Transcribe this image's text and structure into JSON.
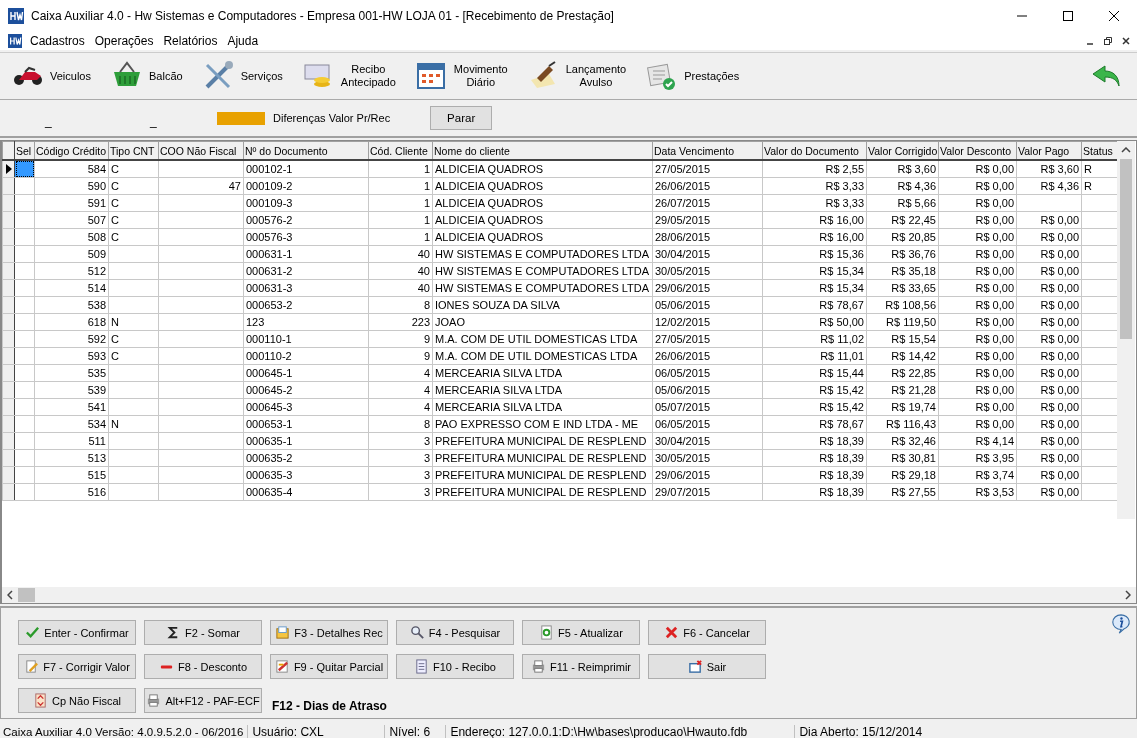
{
  "window": {
    "title": "Caixa Auxiliar 4.0 - Hw Sistemas e Computadores - Empresa 001-HW LOJA 01 - [Recebimento de Prestação]"
  },
  "menu": [
    "Cadastros",
    "Operações",
    "Relatórios",
    "Ajuda"
  ],
  "toolbar": [
    {
      "label": "Veiculos"
    },
    {
      "label": "Balcão"
    },
    {
      "label": "Serviços"
    },
    {
      "label": "Recibo\nAntecipado"
    },
    {
      "label": "Movimento\nDiário"
    },
    {
      "label": "Lançamento\nAvulso"
    },
    {
      "label": "Prestações"
    }
  ],
  "filter_bar": {
    "marks": [
      "_",
      "_"
    ],
    "legend": {
      "label": "Diferenças  Valor Pr/Rec",
      "color": "#e8a100"
    },
    "button": "Parar"
  },
  "table": {
    "columns": [
      "Sel",
      "Código Crédito",
      "Tipo CNT",
      "COO Não Fiscal",
      "Nº do Documento",
      "Cód. Cliente",
      "Nome do cliente",
      "Data Vencimento",
      "Valor do Documento",
      "Valor Corrigido",
      "Valor Desconto",
      "Valor Pago",
      "Status"
    ],
    "rows": [
      {
        "selected": true,
        "codigo": "584",
        "tipo": "C",
        "doc": "000102-1",
        "cliente": "1",
        "nome": "ALDICEIA QUADROS",
        "venc": "27/05/2015",
        "valor": "R$ 2,55",
        "corrigido": "R$ 3,60",
        "desconto": "R$ 0,00",
        "pago": "R$ 3,60",
        "status": "R"
      },
      {
        "selected": false,
        "codigo": "590",
        "tipo": "C",
        "coo": "47",
        "doc": "000109-2",
        "cliente": "1",
        "nome": "ALDICEIA QUADROS",
        "venc": "26/06/2015",
        "valor": "R$ 3,33",
        "corrigido": "R$ 4,36",
        "desconto": "R$ 0,00",
        "pago": "R$ 4,36",
        "status": "R"
      },
      {
        "selected": false,
        "codigo": "591",
        "tipo": "C",
        "doc": "000109-3",
        "cliente": "1",
        "nome": "ALDICEIA QUADROS",
        "venc": "26/07/2015",
        "valor": "R$ 3,33",
        "corrigido": "R$ 5,66",
        "desconto": "R$ 0,00"
      },
      {
        "selected": false,
        "codigo": "507",
        "tipo": "C",
        "doc": "000576-2",
        "cliente": "1",
        "nome": "ALDICEIA QUADROS",
        "venc": "29/05/2015",
        "valor": "R$ 16,00",
        "corrigido": "R$ 22,45",
        "desconto": "R$ 0,00",
        "pago": "R$ 0,00"
      },
      {
        "selected": false,
        "codigo": "508",
        "tipo": "C",
        "doc": "000576-3",
        "cliente": "1",
        "nome": "ALDICEIA QUADROS",
        "venc": "28/06/2015",
        "valor": "R$ 16,00",
        "corrigido": "R$ 20,85",
        "desconto": "R$ 0,00",
        "pago": "R$ 0,00"
      },
      {
        "selected": false,
        "codigo": "509",
        "doc": "000631-1",
        "cliente": "40",
        "nome": "HW SISTEMAS E COMPUTADORES LTDA",
        "venc": "30/04/2015",
        "valor": "R$ 15,36",
        "corrigido": "R$ 36,76",
        "desconto": "R$ 0,00",
        "pago": "R$ 0,00"
      },
      {
        "selected": false,
        "codigo": "512",
        "doc": "000631-2",
        "cliente": "40",
        "nome": "HW SISTEMAS E COMPUTADORES LTDA",
        "venc": "30/05/2015",
        "valor": "R$ 15,34",
        "corrigido": "R$ 35,18",
        "desconto": "R$ 0,00",
        "pago": "R$ 0,00"
      },
      {
        "selected": false,
        "codigo": "514",
        "doc": "000631-3",
        "cliente": "40",
        "nome": "HW SISTEMAS E COMPUTADORES LTDA",
        "venc": "29/06/2015",
        "valor": "R$ 15,34",
        "corrigido": "R$ 33,65",
        "desconto": "R$ 0,00",
        "pago": "R$ 0,00"
      },
      {
        "selected": false,
        "codigo": "538",
        "doc": "000653-2",
        "cliente": "8",
        "nome": "IONES SOUZA DA SILVA",
        "venc": "05/06/2015",
        "valor": "R$ 78,67",
        "corrigido": "R$ 108,56",
        "desconto": "R$ 0,00",
        "pago": "R$ 0,00"
      },
      {
        "selected": false,
        "codigo": "618",
        "tipo": "N",
        "doc": "123",
        "cliente": "223",
        "nome": "JOAO",
        "venc": "12/02/2015",
        "valor": "R$ 50,00",
        "corrigido": "R$ 119,50",
        "desconto": "R$ 0,00",
        "pago": "R$ 0,00"
      },
      {
        "selected": false,
        "codigo": "592",
        "tipo": "C",
        "doc": "000110-1",
        "cliente": "9",
        "nome": "M.A. COM DE UTIL DOMESTICAS LTDA",
        "venc": "27/05/2015",
        "valor": "R$ 11,02",
        "corrigido": "R$ 15,54",
        "desconto": "R$ 0,00",
        "pago": "R$ 0,00"
      },
      {
        "selected": false,
        "codigo": "593",
        "tipo": "C",
        "doc": "000110-2",
        "cliente": "9",
        "nome": "M.A. COM DE UTIL DOMESTICAS LTDA",
        "venc": "26/06/2015",
        "valor": "R$ 11,01",
        "corrigido": "R$ 14,42",
        "desconto": "R$ 0,00",
        "pago": "R$ 0,00"
      },
      {
        "selected": false,
        "codigo": "535",
        "doc": "000645-1",
        "cliente": "4",
        "nome": "MERCEARIA SILVA LTDA",
        "venc": "06/05/2015",
        "valor": "R$ 15,44",
        "corrigido": "R$ 22,85",
        "desconto": "R$ 0,00",
        "pago": "R$ 0,00"
      },
      {
        "selected": false,
        "codigo": "539",
        "doc": "000645-2",
        "cliente": "4",
        "nome": "MERCEARIA SILVA LTDA",
        "venc": "05/06/2015",
        "valor": "R$ 15,42",
        "corrigido": "R$ 21,28",
        "desconto": "R$ 0,00",
        "pago": "R$ 0,00"
      },
      {
        "selected": false,
        "codigo": "541",
        "doc": "000645-3",
        "cliente": "4",
        "nome": "MERCEARIA SILVA LTDA",
        "venc": "05/07/2015",
        "valor": "R$ 15,42",
        "corrigido": "R$ 19,74",
        "desconto": "R$ 0,00",
        "pago": "R$ 0,00"
      },
      {
        "selected": false,
        "codigo": "534",
        "tipo": "N",
        "doc": "000653-1",
        "cliente": "8",
        "nome": "PAO EXPRESSO COM E IND LTDA - ME",
        "venc": "06/05/2015",
        "valor": "R$ 78,67",
        "corrigido": "R$ 116,43",
        "desconto": "R$ 0,00",
        "pago": "R$ 0,00"
      },
      {
        "selected": false,
        "codigo": "511",
        "doc": "000635-1",
        "cliente": "3",
        "nome": "PREFEITURA MUNICIPAL DE RESPLEND",
        "venc": "30/04/2015",
        "valor": "R$ 18,39",
        "corrigido": "R$ 32,46",
        "desconto": "R$ 4,14",
        "pago": "R$ 0,00"
      },
      {
        "selected": false,
        "codigo": "513",
        "doc": "000635-2",
        "cliente": "3",
        "nome": "PREFEITURA MUNICIPAL DE RESPLEND",
        "venc": "30/05/2015",
        "valor": "R$ 18,39",
        "corrigido": "R$ 30,81",
        "desconto": "R$ 3,95",
        "pago": "R$ 0,00"
      },
      {
        "selected": false,
        "codigo": "515",
        "doc": "000635-3",
        "cliente": "3",
        "nome": "PREFEITURA MUNICIPAL DE RESPLEND",
        "venc": "29/06/2015",
        "valor": "R$ 18,39",
        "corrigido": "R$ 29,18",
        "desconto": "R$ 3,74",
        "pago": "R$ 0,00"
      },
      {
        "selected": false,
        "codigo": "516",
        "doc": "000635-4",
        "cliente": "3",
        "nome": "PREFEITURA MUNICIPAL DE RESPLEND",
        "venc": "29/07/2015",
        "valor": "R$ 18,39",
        "corrigido": "R$ 27,55",
        "desconto": "R$ 3,53",
        "pago": "R$ 0,00"
      }
    ]
  },
  "actions": [
    "Enter - Confirmar",
    "F2 - Somar",
    "F3 - Detalhes Rec",
    "F4 - Pesquisar",
    "F5 - Atualizar",
    "F6 - Cancelar",
    "F7 - Corrigir Valor",
    "F8 - Desconto",
    "F9 - Quitar Parcial",
    "F10 - Recibo",
    "F11 - Reimprimir",
    "Sair",
    "Cp Não Fiscal",
    "Alt+F12 - PAF-ECF"
  ],
  "shortcut_note": "F12 - Dias de Atraso",
  "status_bar": [
    "Caixa Auxiliar 4.0 Versão: 4.0.9.5.2.0 - 06/2016",
    "Usuário: CXL",
    "Nível: 6",
    "Endereço: 127.0.0.1:D:\\Hw\\bases\\producao\\Hwauto.fdb",
    "Dia Aberto: 15/12/2014"
  ]
}
